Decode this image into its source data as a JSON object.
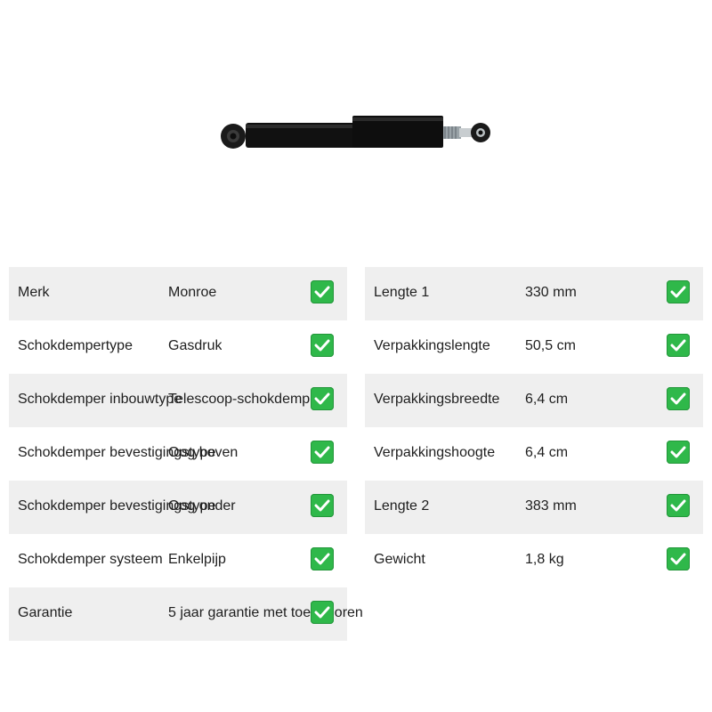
{
  "product": {
    "image_icon": "shock-absorber-image"
  },
  "colors": {
    "row_shade": "#efefef",
    "check_green": "#2fb84a"
  },
  "left_specs": [
    {
      "label": "Merk",
      "value": "Monroe",
      "icon": "check-icon"
    },
    {
      "label": "Schokdempertype",
      "value": "Gasdruk",
      "icon": "check-icon"
    },
    {
      "label": "Schokdemper inbouwtype",
      "value": "Telescoop-schokdemper",
      "icon": "check-icon"
    },
    {
      "label": "Schokdemper bevestigingstype",
      "value": "Oog boven",
      "icon": "check-icon"
    },
    {
      "label": "Schokdemper bevestigingstype",
      "value": "Oog onder",
      "icon": "check-icon"
    },
    {
      "label": "Schokdemper systeem",
      "value": "Enkelpijp",
      "icon": "check-icon"
    },
    {
      "label": "Garantie",
      "value": "5 jaar garantie met toebehoren",
      "icon": "check-icon"
    }
  ],
  "right_specs": [
    {
      "label": "Lengte 1",
      "value": "330 mm",
      "icon": "check-icon"
    },
    {
      "label": "Verpakkingslengte",
      "value": "50,5 cm",
      "icon": "check-icon"
    },
    {
      "label": "Verpakkingsbreedte",
      "value": "6,4 cm",
      "icon": "check-icon"
    },
    {
      "label": "Verpakkingshoogte",
      "value": "6,4 cm",
      "icon": "check-icon"
    },
    {
      "label": "Lengte 2",
      "value": "383 mm",
      "icon": "check-icon"
    },
    {
      "label": "Gewicht",
      "value": "1,8 kg",
      "icon": "check-icon"
    }
  ]
}
